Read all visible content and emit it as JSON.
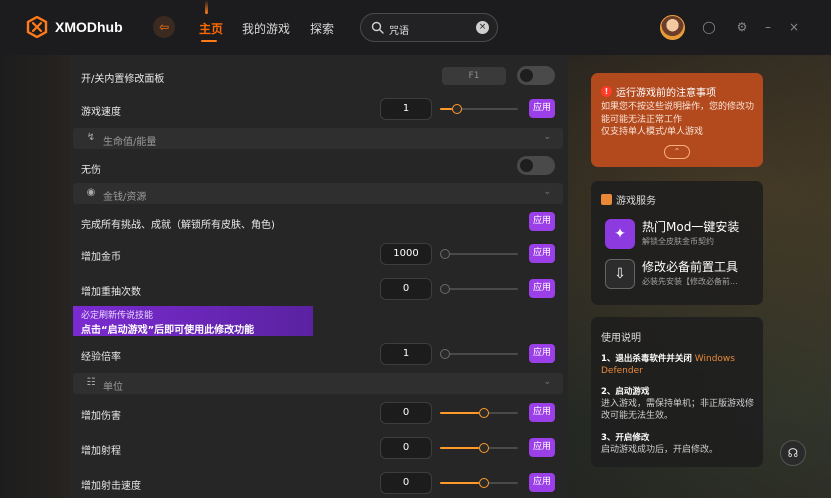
{
  "app": {
    "name": "XMODhub"
  },
  "nav": {
    "home": "主页",
    "games": "我的游戏",
    "explore": "探索"
  },
  "search": {
    "value": "咒语"
  },
  "rows": {
    "overlay": {
      "label": "开/关内置修改面板",
      "hotkey": "F1",
      "enabled": false
    },
    "speed": {
      "label": "游戏速度",
      "value": "1",
      "level": 0.15
    },
    "god": {
      "label": "无伤",
      "enabled": false
    },
    "challenges": {
      "label": "完成所有挑战、成就（解锁所有皮肤、角色)"
    },
    "gold": {
      "label": "增加金币",
      "value": "1000",
      "level": 0
    },
    "reroll": {
      "label": "增加重抽次数",
      "value": "0",
      "level": 0
    },
    "exp": {
      "label": "经验倍率",
      "value": "1",
      "level": 0
    },
    "damage": {
      "label": "增加伤害",
      "value": "0",
      "level": 0.5
    },
    "range": {
      "label": "增加射程",
      "value": "0",
      "level": 0.5
    },
    "firerate": {
      "label": "增加射击速度",
      "value": "0",
      "level": 0.5
    }
  },
  "sections": {
    "health": "生命值/能量",
    "money": "金钱/资源",
    "unit": "单位"
  },
  "apply_label": "应用",
  "banner": {
    "line1": "必定刷新传说技能",
    "line2": "点击“启动游戏”后即可使用此修改功能"
  },
  "notice": {
    "title": "运行游戏前的注意事项",
    "body_1": "如果您不按这些说明操作，您的修改功能可能无法正常工作",
    "body_2": "仅支持单人模式/单人游戏"
  },
  "services": {
    "title": "游戏服务",
    "items": [
      {
        "title": "热门Mod一键安装",
        "subtitle": "解锁全皮肤金币契约"
      },
      {
        "title": "修改必备前置工具",
        "subtitle": "必装先安装【修改必备前..."
      }
    ]
  },
  "usage": {
    "title": "使用说明",
    "step1_title": "1、退出杀毒软件并关闭",
    "step1_highlight": "Windows Defender",
    "step2_title": "2、启动游戏",
    "step2_body": "进入游戏，需保持单机；非正版游戏修改可能无法生效。",
    "step3_title": "3、开启修改",
    "step3_body": "启动游戏成功后，开启修改。"
  },
  "colors": {
    "accent": "#ff7a1a",
    "apply": "#9b3fe8",
    "notice": "#b24a1e"
  },
  "icons": {
    "logo": "xmod-logo-icon",
    "back": "arrow-left-icon",
    "search": "search-icon",
    "clear": "clear-icon",
    "health": "lightning-icon",
    "money": "coin-bag-icon",
    "unit": "unit-icon",
    "notice": "warning-icon",
    "service": "cube-icon",
    "mod": "puzzle-icon",
    "tool": "download-icon",
    "support": "headset-icon"
  }
}
